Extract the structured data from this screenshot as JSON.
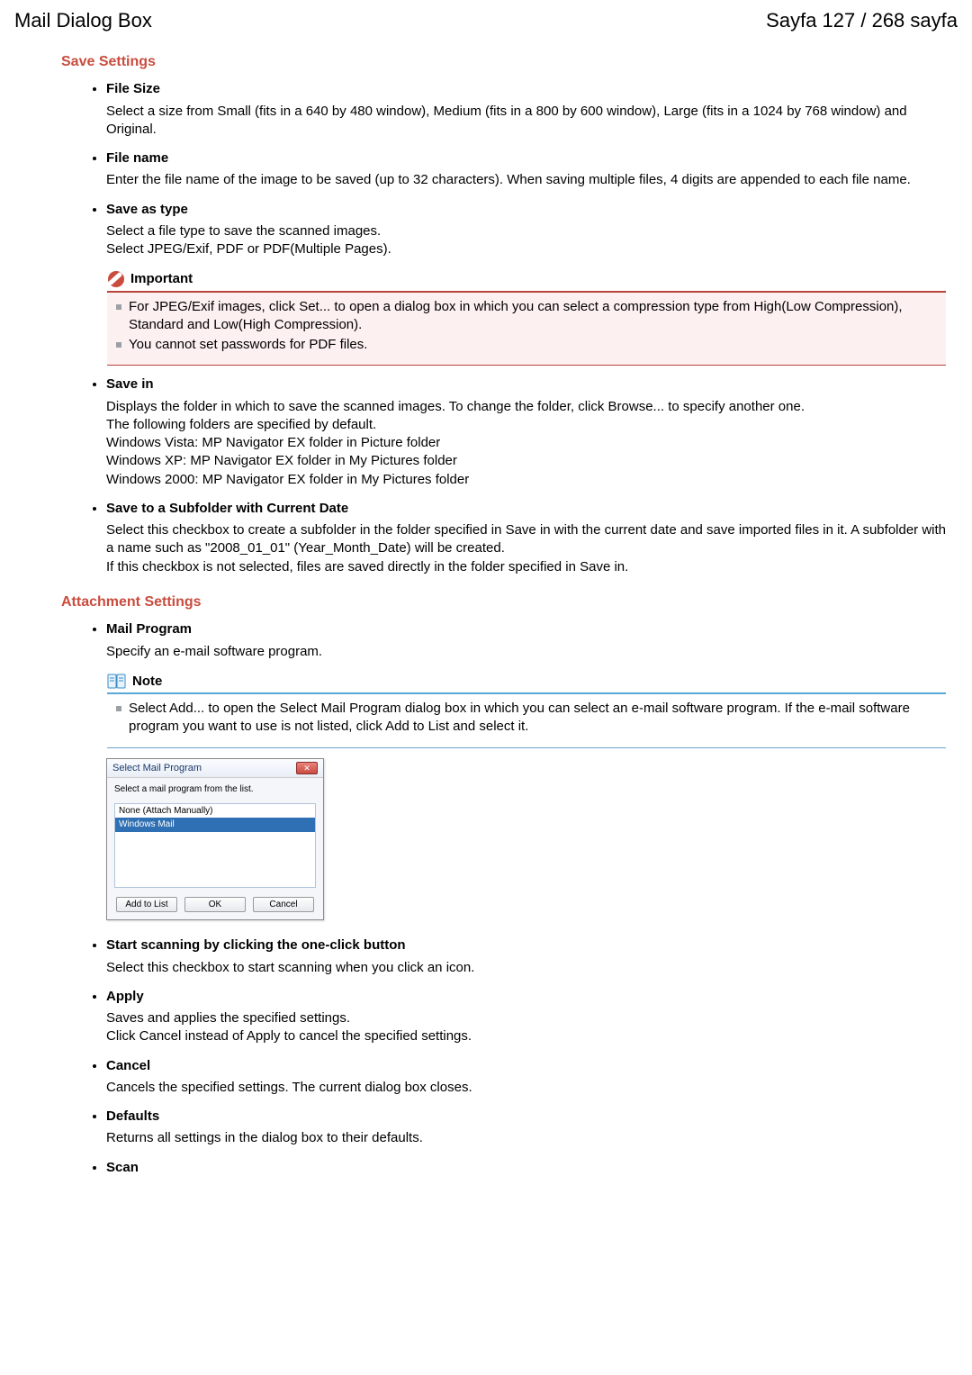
{
  "header": {
    "left": "Mail Dialog Box",
    "right": "Sayfa 127 / 268 sayfa"
  },
  "sections": {
    "save": {
      "title": "Save Settings",
      "file_size": {
        "title": "File Size",
        "body": "Select a size from Small (fits in a 640 by 480 window), Medium (fits in a 800 by 600 window), Large (fits in a 1024 by 768 window) and Original."
      },
      "file_name": {
        "title": "File name",
        "body": "Enter the file name of the image to be saved (up to 32 characters). When saving multiple files, 4 digits are appended to each file name."
      },
      "save_as_type": {
        "title": "Save as type",
        "body1": "Select a file type to save the scanned images.",
        "body2": "Select JPEG/Exif, PDF or PDF(Multiple Pages).",
        "important_label": "Important",
        "important_items": [
          "For JPEG/Exif images, click Set... to open a dialog box in which you can select a compression type from High(Low Compression), Standard and Low(High Compression).",
          "You cannot set passwords for PDF files."
        ]
      },
      "save_in": {
        "title": "Save in",
        "body1": "Displays the folder in which to save the scanned images. To change the folder, click Browse... to specify another one.",
        "body2": "The following folders are specified by default.",
        "body3": "Windows Vista: MP Navigator EX folder in Picture folder",
        "body4": "Windows XP: MP Navigator EX folder in My Pictures folder",
        "body5": "Windows 2000: MP Navigator EX folder in My Pictures folder"
      },
      "subfolder": {
        "title": "Save to a Subfolder with Current Date",
        "body1": "Select this checkbox to create a subfolder in the folder specified in Save in with the current date and save imported files in it. A subfolder with a name such as \"2008_01_01\" (Year_Month_Date) will be created.",
        "body2": "If this checkbox is not selected, files are saved directly in the folder specified in Save in."
      }
    },
    "attachment": {
      "title": "Attachment Settings",
      "mail_program": {
        "title": "Mail Program",
        "body": "Specify an e-mail software program.",
        "note_label": "Note",
        "note_item": "Select Add... to open the Select Mail Program dialog box in which you can select an e-mail software program. If the e-mail software program you want to use is not listed, click Add to List and select it."
      },
      "dialog": {
        "title": "Select Mail Program",
        "prompt": "Select a mail program from the list.",
        "item1": "None (Attach Manually)",
        "item2": "Windows Mail",
        "btn_add": "Add to List",
        "btn_ok": "OK",
        "btn_cancel": "Cancel"
      },
      "start_scanning": {
        "title": "Start scanning by clicking the one-click button",
        "body": "Select this checkbox to start scanning when you click an icon."
      },
      "apply": {
        "title": "Apply",
        "body1": "Saves and applies the specified settings.",
        "body2": "Click Cancel instead of Apply to cancel the specified settings."
      },
      "cancel": {
        "title": "Cancel",
        "body": "Cancels the specified settings. The current dialog box closes."
      },
      "defaults": {
        "title": "Defaults",
        "body": "Returns all settings in the dialog box to their defaults."
      },
      "scan": {
        "title": "Scan"
      }
    }
  }
}
